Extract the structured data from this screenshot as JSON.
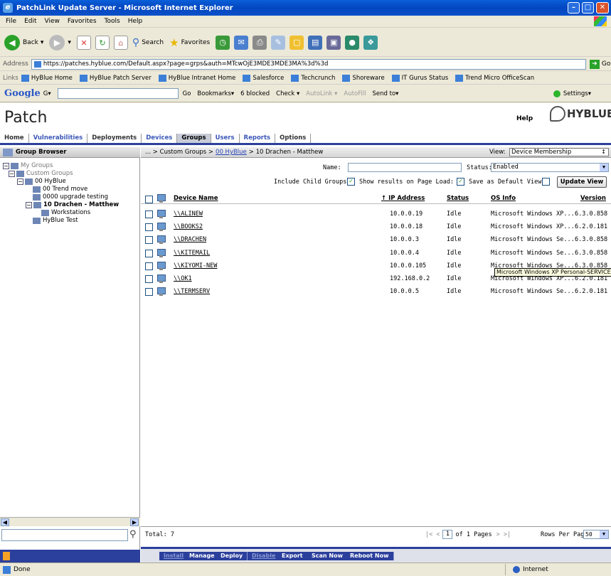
{
  "window": {
    "title": "PatchLink Update Server - Microsoft Internet Explorer",
    "min": "–",
    "max": "□",
    "close": "✕"
  },
  "menu": [
    "File",
    "Edit",
    "View",
    "Favorites",
    "Tools",
    "Help"
  ],
  "toolbar": {
    "back": "Back",
    "search": "Search",
    "favorites": "Favorites"
  },
  "address": {
    "label": "Address",
    "url": "https://patches.hyblue.com/Default.aspx?page=grps&auth=MTcwOjE3MDE3MDE3MA%3d%3d",
    "go": "Go"
  },
  "links": {
    "label": "Links",
    "items": [
      "HyBlue Home",
      "HyBlue Patch Server",
      "HyBlue Intranet Home",
      "Salesforce",
      "Techcrunch",
      "Shoreware",
      "IT Gurus Status",
      "Trend Micro OfficeScan"
    ]
  },
  "google": {
    "logo": "Google",
    "g": "G▾",
    "go": "Go",
    "bookmarks": "Bookmarks▾",
    "blocked": "6 blocked",
    "check": "Check ▾",
    "autolink": "AutoLink ▾",
    "autofill": "AutoFill",
    "sendto": "Send to▾",
    "settings": "Settings▾"
  },
  "app": {
    "title": "Patch",
    "help": "Help",
    "logo": "HYBLUE",
    "tabs": [
      {
        "label": "Home",
        "style": ""
      },
      {
        "label": "Vulnerabilities",
        "style": "blue"
      },
      {
        "label": "Deployments",
        "style": ""
      },
      {
        "label": "Devices",
        "style": "blue"
      },
      {
        "label": "Groups",
        "style": "active"
      },
      {
        "label": "Users",
        "style": "blue"
      },
      {
        "label": "Reports",
        "style": "blue"
      },
      {
        "label": "Options",
        "style": ""
      }
    ]
  },
  "sidebar": {
    "title": "Group Browser",
    "tree": {
      "my_groups": "My Groups",
      "custom_groups": "Custom Groups",
      "hyblue": "00 HyBlue",
      "trend": "00 Trend move",
      "upgrade": "0000 upgrade testing",
      "drachen": "10 Drachen - Matthew",
      "workstations": "Workstations",
      "test": "HyBlue Test"
    }
  },
  "main": {
    "breadcrumb": {
      "prefix": "... > Custom Groups >",
      "link": "00 HyBlue",
      "suffix": "> 10 Drachen - Matthew"
    },
    "view_label": "View:",
    "view_value": "Device Membership",
    "name_label": "Name:",
    "status_label": "Status:",
    "status_value": "Enabled",
    "include_child": "Include Child Groups:",
    "show_results": "Show results on Page Load:",
    "save_default": "Save as Default View:",
    "update_view": "Update View",
    "columns": {
      "device": "Device Name",
      "ip": "↑ IP Address",
      "status": "Status",
      "os": "OS Info",
      "version": "Version"
    },
    "rows": [
      {
        "name": "\\\\ALINEW",
        "ip": "10.0.0.19",
        "status": "Idle",
        "os": "Microsoft Windows XP...",
        "version": "6.3.0.858"
      },
      {
        "name": "\\\\BOOKS2",
        "ip": "10.0.0.18",
        "status": "Idle",
        "os": "Microsoft Windows XP...",
        "version": "6.2.0.181"
      },
      {
        "name": "\\\\DRACHEN",
        "ip": "10.0.0.3",
        "status": "Idle",
        "os": "Microsoft Windows Se...",
        "version": "6.3.0.858"
      },
      {
        "name": "\\\\KITEMAIL",
        "ip": "10.0.0.4",
        "status": "Idle",
        "os": "Microsoft Windows Se...",
        "version": "6.3.0.858"
      },
      {
        "name": "\\\\KIYOMI-NEW",
        "ip": "10.0.0.105",
        "status": "Idle",
        "os": "Microsoft Windows Se...",
        "version": "6.3.0.858"
      },
      {
        "name": "\\\\OK1",
        "ip": "192.168.0.2",
        "status": "Idle",
        "os": "Microsoft Windows XP...",
        "version": "6.2.0.181"
      },
      {
        "name": "\\\\TERMSERV",
        "ip": "10.0.0.5",
        "status": "Idle",
        "os": "Microsoft Windows Se...",
        "version": "6.2.0.181"
      }
    ],
    "tooltip": "Microsoft Windows XP Personal-SERVICE",
    "total": "Total: 7",
    "pager_prev": "|< <",
    "page": "1",
    "pages": "of 1 Pages",
    "pager_next": "> >|",
    "rows_per_page": "Rows Per Page:",
    "rows_per_page_value": "50",
    "actions": [
      {
        "label": "Install",
        "dim": true
      },
      {
        "label": "Manage",
        "dim": false
      },
      {
        "label": "Deploy",
        "dim": false
      },
      {
        "label": "Disable",
        "dim": true
      },
      {
        "label": "Export",
        "dim": false
      },
      {
        "label": "Scan Now",
        "dim": false
      },
      {
        "label": "Reboot Now",
        "dim": false
      }
    ]
  },
  "statusbar": {
    "text": "Done",
    "zone": "Internet"
  }
}
